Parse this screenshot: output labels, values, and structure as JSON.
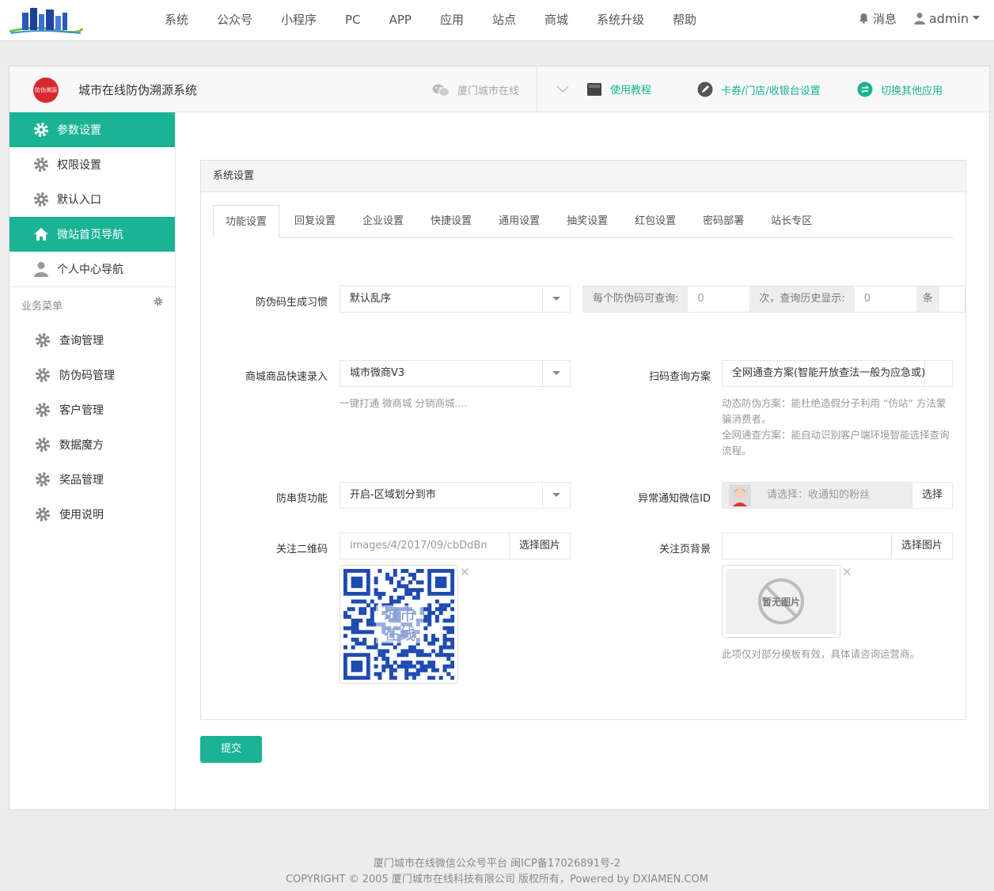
{
  "topnav": {
    "items": [
      "系统",
      "公众号",
      "小程序",
      "PC",
      "APP",
      "应用",
      "站点",
      "商城",
      "系统升级",
      "帮助"
    ],
    "messages": "消息",
    "user": "admin"
  },
  "header": {
    "logo_text": "防伪溯源",
    "app_title": "城市在线防伪溯源系统",
    "account": "厦门城市在线",
    "links": {
      "tutorial": "使用教程",
      "card_settings": "卡券/门店/收银台设置",
      "switch_app": "切换其他应用"
    }
  },
  "sidebar": {
    "items": [
      {
        "label": "参数设置",
        "active": true
      },
      {
        "label": "权限设置",
        "active": false
      },
      {
        "label": "默认入口",
        "active": false
      },
      {
        "label": "微站首页导航",
        "active": true
      },
      {
        "label": "个人中心导航",
        "active": false
      }
    ],
    "biz_label": "业务菜单",
    "biz_items": [
      "查询管理",
      "防伪码管理",
      "客户管理",
      "数据魔方",
      "奖品管理",
      "使用说明"
    ]
  },
  "panel": {
    "title": "系统设置",
    "tabs": [
      "功能设置",
      "回复设置",
      "企业设置",
      "快捷设置",
      "通用设置",
      "抽奖设置",
      "红包设置",
      "密码部署",
      "站长专区"
    ]
  },
  "form": {
    "code_habit": {
      "label": "防伪码生成习惯",
      "value": "默认乱序"
    },
    "query_limit": {
      "prefix": "每个防伪码可查询:",
      "value": "0",
      "middle": "次，查询历史显示:",
      "value2": "0",
      "suffix": "条"
    },
    "mall_entry": {
      "label": "商城商品快速录入",
      "value": "城市微商V3",
      "help": "一键打通 微商城 分销商城...."
    },
    "scan_plan": {
      "label": "扫码查询方案",
      "value": "全网通查方案(智能开放查法一般为应急或)",
      "help1": "动态防伪方案：能杜绝造假分子利用 “仿站” 方法蒙骗消费者。",
      "help2": "全网通查方案：能自动识别客户端环境智能选择查询流程。"
    },
    "anti_flee": {
      "label": "防串货功能",
      "value": "开启-区域划分到市"
    },
    "notify_wechat": {
      "label": "异常通知微信ID",
      "placeholder": "请选择：收通知的粉丝",
      "button": "选择"
    },
    "qrcode": {
      "label": "关注二维码",
      "value": "images/4/2017/09/cbDdBn",
      "button": "选择图片",
      "overlay": "城市\n在线"
    },
    "follow_bg": {
      "label": "关注页背景",
      "value": "",
      "button": "选择图片",
      "noimg": "暂无图片",
      "help": "此项仅对部分模板有效，具体请咨询运营商。"
    }
  },
  "submit_label": "提交",
  "footer": {
    "line1": "厦门城市在线微信公众号平台 闽ICP备17026891号-2",
    "line2": "COPYRIGHT © 2005 厦门城市在线科技有限公司 版权所有，Powered by DXIAMEN.COM"
  },
  "colors": {
    "accent": "#1ab394",
    "background": "#ececec"
  }
}
